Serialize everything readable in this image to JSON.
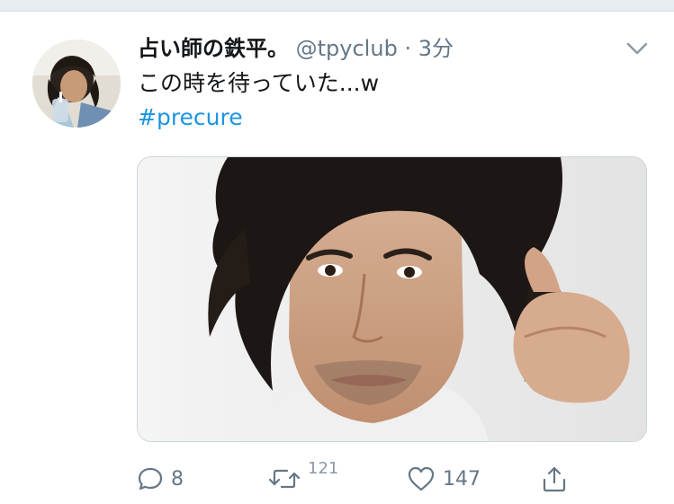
{
  "tweet": {
    "display_name": "占い師の鉄平。",
    "handle": "@tpyclub",
    "separator": "·",
    "time": "3分",
    "text": "この時を待っていた...w",
    "hashtag": "#precure",
    "avatar_icon": "profile-photo",
    "caret_icon": "chevron-down-icon",
    "media_icon": "photo"
  },
  "actions": {
    "reply_count": "8",
    "retweet_count": "121",
    "like_count": "147",
    "reply_icon": "reply-icon",
    "retweet_icon": "retweet-icon",
    "like_icon": "heart-icon",
    "share_icon": "share-icon"
  },
  "colors": {
    "link": "#1b95e0",
    "secondary": "#657786",
    "primary_text": "#14171a",
    "divider": "#e6ecf0"
  }
}
